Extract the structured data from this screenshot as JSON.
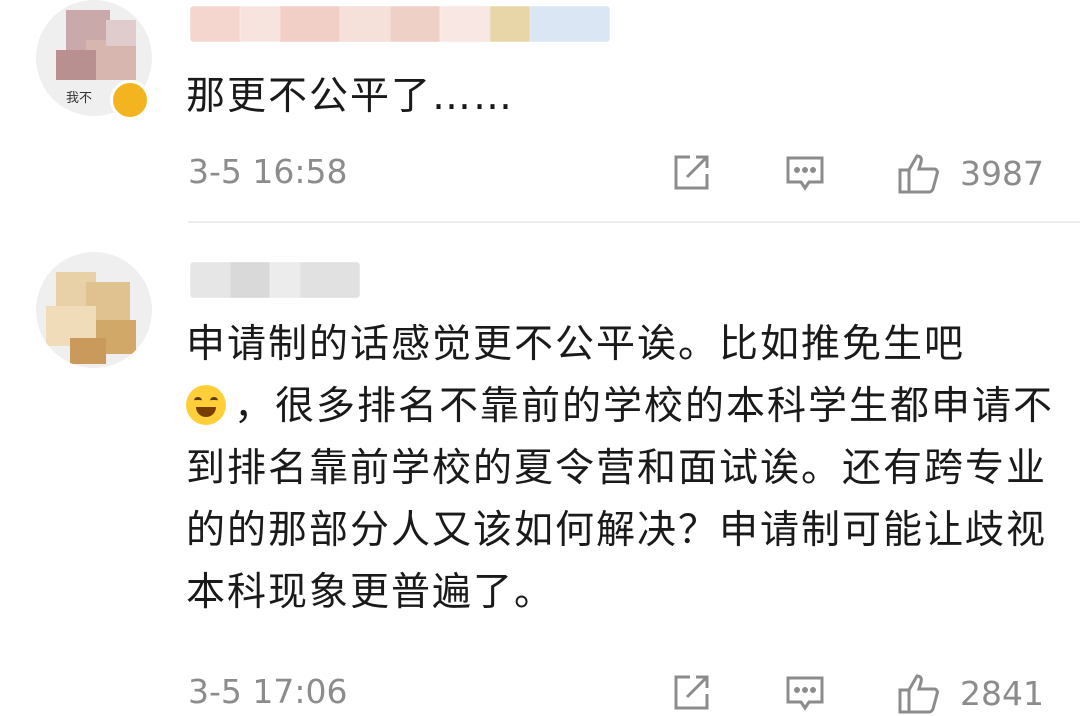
{
  "comments": [
    {
      "avatar_tag": "我不",
      "text": "那更不公平了……",
      "time": "3-5 16:58",
      "likes": "3987"
    },
    {
      "text_before_emoji": "申请制的话感觉更不公平诶。比如推免生吧",
      "text_after_emoji": "，很多排名不靠前的学校的本科学生都申请不到排名靠前学校的夏令营和面试诶。还有跨专业的的那部分人又该如何解决？申请制可能让歧视本科现象更普遍了。",
      "emoji": "laugh-cry-emoji",
      "time": "3-5 17:06",
      "likes": "2841"
    }
  ],
  "icons": {
    "share": "share-icon",
    "reply": "comment-icon",
    "like": "thumbs-up-icon"
  },
  "colors": {
    "meta_text": "#8c8c8c",
    "icon": "#8c8c8c"
  }
}
